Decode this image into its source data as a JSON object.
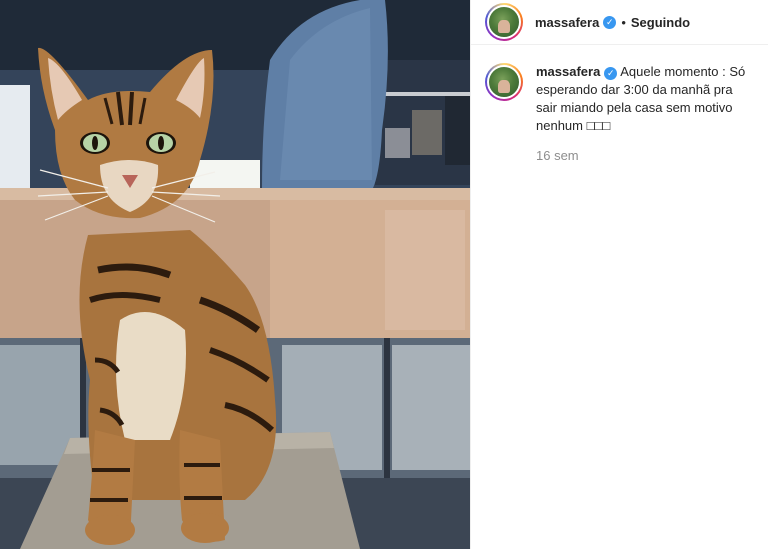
{
  "post": {
    "author": {
      "username": "massafera",
      "verified_icon": "verified-badge-icon",
      "follow_separator": "•",
      "follow_state": "Seguindo"
    },
    "caption": {
      "username": "massafera",
      "text": "Aquele momento : Só esperando dar 3:00 da manhã pra sair miando pela casa sem motivo nenhum",
      "emoji_placeholder": "□□□",
      "time_ago": "16 sem"
    },
    "image": {
      "subject": "bengal-cat-photo"
    }
  }
}
